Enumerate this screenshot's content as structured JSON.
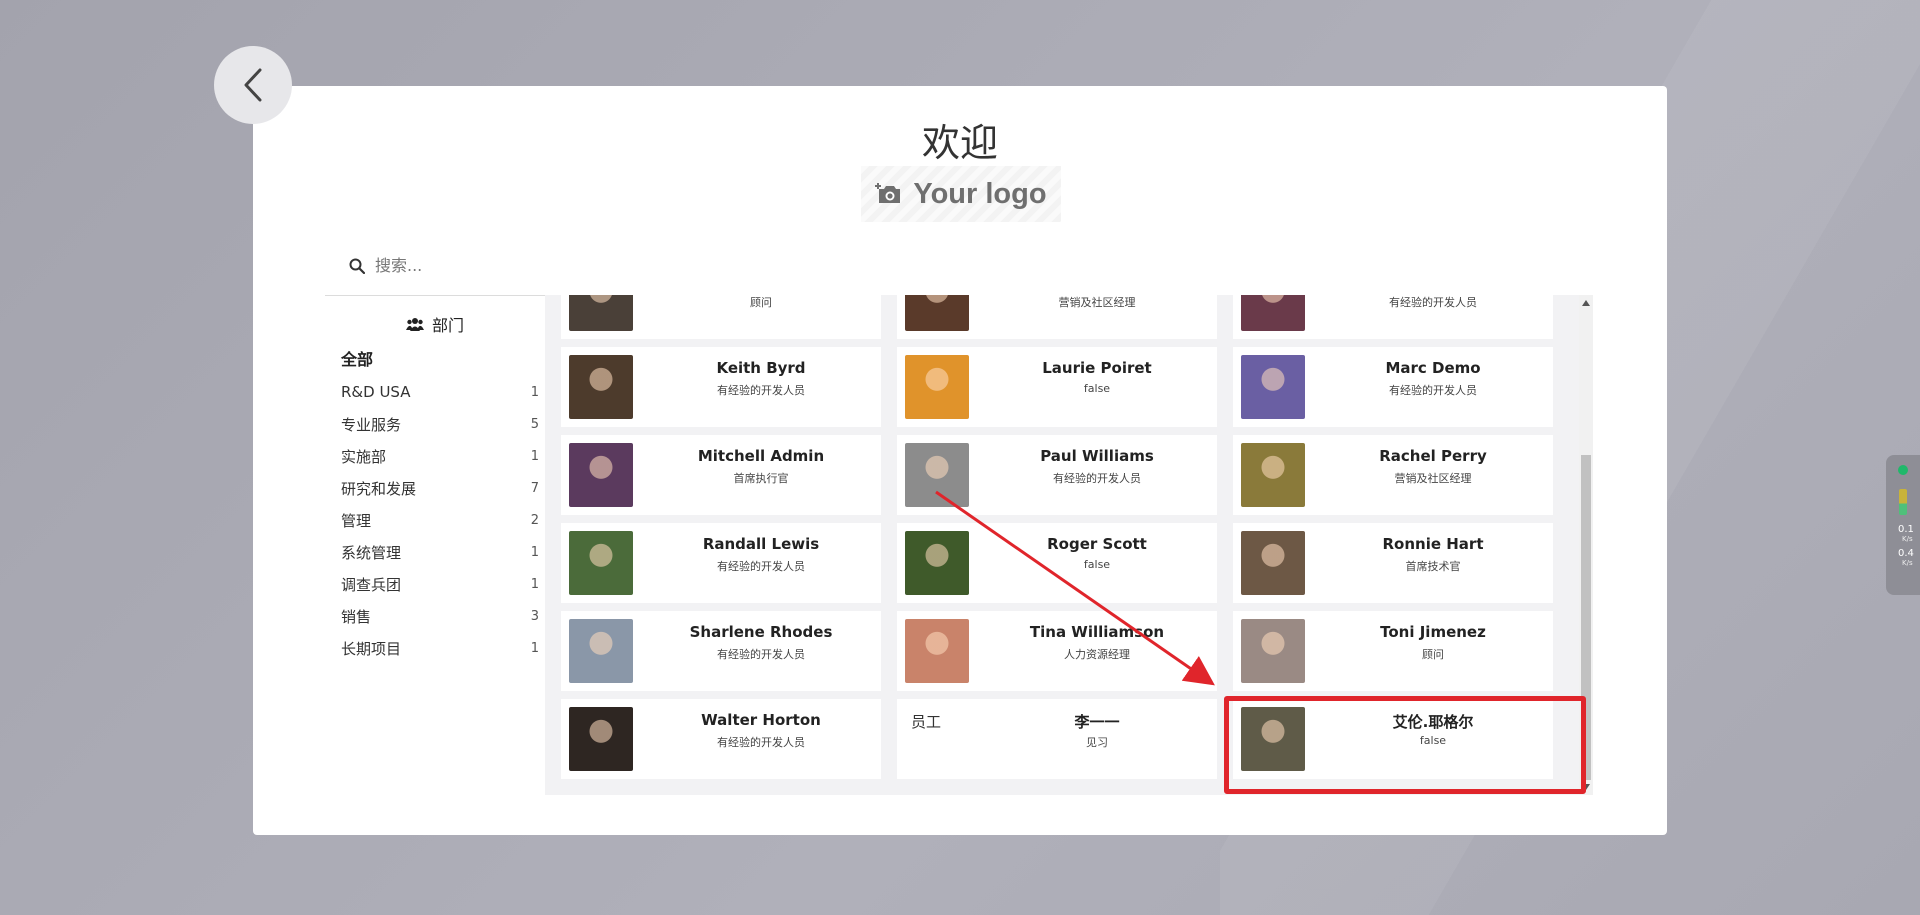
{
  "page": {
    "title": "欢迎",
    "logo_text": "Your logo"
  },
  "search": {
    "placeholder": "搜索..."
  },
  "sidebar": {
    "heading": "部门",
    "all_label": "全部",
    "items": [
      {
        "label": "R&D USA",
        "count": "1"
      },
      {
        "label": "专业服务",
        "count": "5"
      },
      {
        "label": "实施部",
        "count": "1"
      },
      {
        "label": "研究和发展",
        "count": "7"
      },
      {
        "label": "管理",
        "count": "2"
      },
      {
        "label": "系统管理",
        "count": "1"
      },
      {
        "label": "调查兵团",
        "count": "1"
      },
      {
        "label": "销售",
        "count": "3"
      },
      {
        "label": "长期项目",
        "count": "1"
      }
    ]
  },
  "employees": [
    {
      "name": "",
      "role": "顾问",
      "avatar_color": "#4a4038"
    },
    {
      "name": "",
      "role": "营销及社区经理",
      "avatar_color": "#5a3a2a"
    },
    {
      "name": "",
      "role": "有经验的开发人员",
      "avatar_color": "#6a3a4a"
    },
    {
      "name": "Keith Byrd",
      "role": "有经验的开发人员",
      "avatar_color": "#4d3b2c"
    },
    {
      "name": "Laurie Poiret",
      "role": "false",
      "avatar_color": "#e0932b"
    },
    {
      "name": "Marc Demo",
      "role": "有经验的开发人员",
      "avatar_color": "#6a5fa3"
    },
    {
      "name": "Mitchell Admin",
      "role": "首席执行官",
      "avatar_color": "#5b3a5e"
    },
    {
      "name": "Paul Williams",
      "role": "有经验的开发人员",
      "avatar_color": "#8c8c8c"
    },
    {
      "name": "Rachel Perry",
      "role": "营销及社区经理",
      "avatar_color": "#8a7a3a"
    },
    {
      "name": "Randall Lewis",
      "role": "有经验的开发人员",
      "avatar_color": "#4b6b3a"
    },
    {
      "name": "Roger Scott",
      "role": "false",
      "avatar_color": "#3f5a2a"
    },
    {
      "name": "Ronnie Hart",
      "role": "首席技术官",
      "avatar_color": "#6d5845"
    },
    {
      "name": "Sharlene Rhodes",
      "role": "有经验的开发人员",
      "avatar_color": "#8a97a8"
    },
    {
      "name": "Tina Williamson",
      "role": "人力资源经理",
      "avatar_color": "#c9836a"
    },
    {
      "name": "Toni Jimenez",
      "role": "顾问",
      "avatar_color": "#9a8a84"
    },
    {
      "name": "Walter Horton",
      "role": "有经验的开发人员",
      "avatar_color": "#2e2622"
    },
    {
      "name": "李一一",
      "role": "见习",
      "avatar_color": "",
      "avatar_alt": "员工"
    },
    {
      "name": "艾伦.耶格尔",
      "role": "false",
      "avatar_color": "#5f5b48"
    }
  ],
  "widget": {
    "upload_value": "0.1",
    "upload_unit": "K/s",
    "download_value": "0.4",
    "download_unit": "K/s"
  },
  "colors": {
    "highlight": "#e0252b",
    "background": "#a8a8b2"
  }
}
